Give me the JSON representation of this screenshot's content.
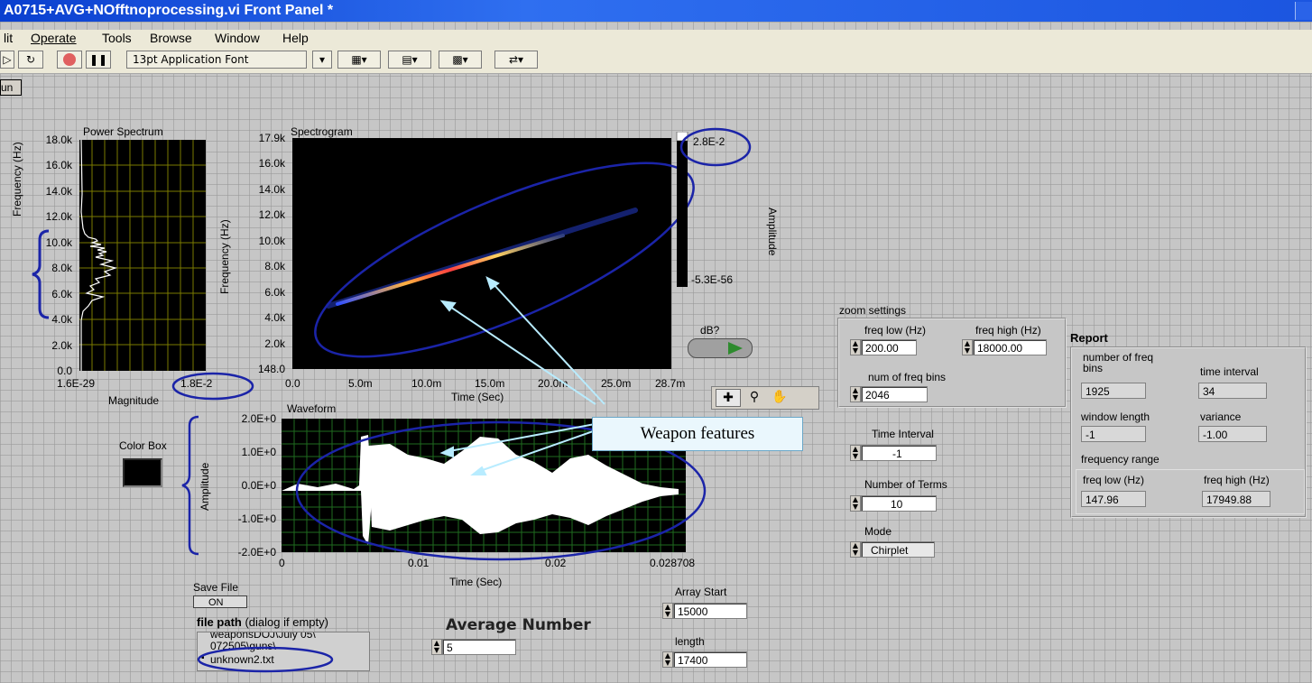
{
  "window": {
    "title": "A0715+AVG+NOfftnoprocessing.vi Front Panel *"
  },
  "menu": [
    "lit",
    "Operate",
    "Tools",
    "Browse",
    "Window",
    "Help"
  ],
  "toolbar": {
    "font_label": "13pt Application Font"
  },
  "run_tab": "un",
  "power_spectrum": {
    "title": "Power Spectrum",
    "ylabel": "Frequency (Hz)",
    "xlabel": "Magnitude",
    "y_ticks": [
      "18.0k",
      "16.0k",
      "14.0k",
      "12.0k",
      "10.0k",
      "8.0k",
      "6.0k",
      "4.0k",
      "2.0k",
      "0.0"
    ],
    "x_ticks": [
      "1.6E-29",
      "1.8E-2"
    ]
  },
  "spectrogram": {
    "title": "Spectrogram",
    "ylabel": "Frequency (Hz)",
    "xlabel": "Time (Sec)",
    "y_ticks": [
      "17.9k",
      "16.0k",
      "14.0k",
      "12.0k",
      "10.0k",
      "8.0k",
      "6.0k",
      "4.0k",
      "2.0k",
      "148.0"
    ],
    "x_ticks": [
      "0.0",
      "5.0m",
      "10.0m",
      "15.0m",
      "20.0m",
      "25.0m",
      "28.7m"
    ],
    "scale_max": "2.8E-2",
    "scale_min": "-5.3E-56",
    "scale_label": "Amplitude"
  },
  "db_toggle": {
    "label": "dB?"
  },
  "waveform": {
    "title": "Waveform",
    "ylabel": "Amplitude",
    "xlabel": "Time (Sec)",
    "y_ticks": [
      "2.0E+0",
      "1.0E+0",
      "0.0E+0",
      "-1.0E+0",
      "-2.0E+0"
    ],
    "x_ticks": [
      "0",
      "0.01",
      "0.02",
      "0.028708"
    ]
  },
  "color_box": {
    "label": "Color Box"
  },
  "annotation": {
    "label": "Weapon features"
  },
  "zoom": {
    "title": "zoom settings",
    "freq_low_label": "freq low (Hz)",
    "freq_low": "200.00",
    "freq_high_label": "freq high (Hz)",
    "freq_high": "18000.00",
    "bins_label": "num of freq bins",
    "bins": "2046"
  },
  "time_interval": {
    "label": "Time Interval",
    "value": "-1"
  },
  "num_terms": {
    "label": "Number of Terms",
    "value": "10"
  },
  "mode": {
    "label": "Mode",
    "value": "Chirplet"
  },
  "report": {
    "title": "Report",
    "bins_label": "number of freq bins",
    "bins": "1925",
    "interval_label": "time interval",
    "interval": "34",
    "window_label": "window length",
    "window": "-1",
    "variance_label": "variance",
    "variance": "-1.00",
    "range_label": "frequency range",
    "low_label": "freq low (Hz)",
    "low": "147.96",
    "high_label": "freq high (Hz)",
    "high": "17949.88"
  },
  "save_file": {
    "label": "Save File",
    "state": "ON"
  },
  "file_path": {
    "label_bold": "file path",
    "label_rest": "(dialog if empty)",
    "lines": [
      "weaponsDOJ\\July 05\\",
      "072505\\guns\\",
      "unknown2.txt"
    ]
  },
  "average": {
    "label": "Average Number",
    "value": "5"
  },
  "array_start": {
    "label": "Array Start",
    "value": "15000"
  },
  "length": {
    "label": "length",
    "value": "17400"
  }
}
